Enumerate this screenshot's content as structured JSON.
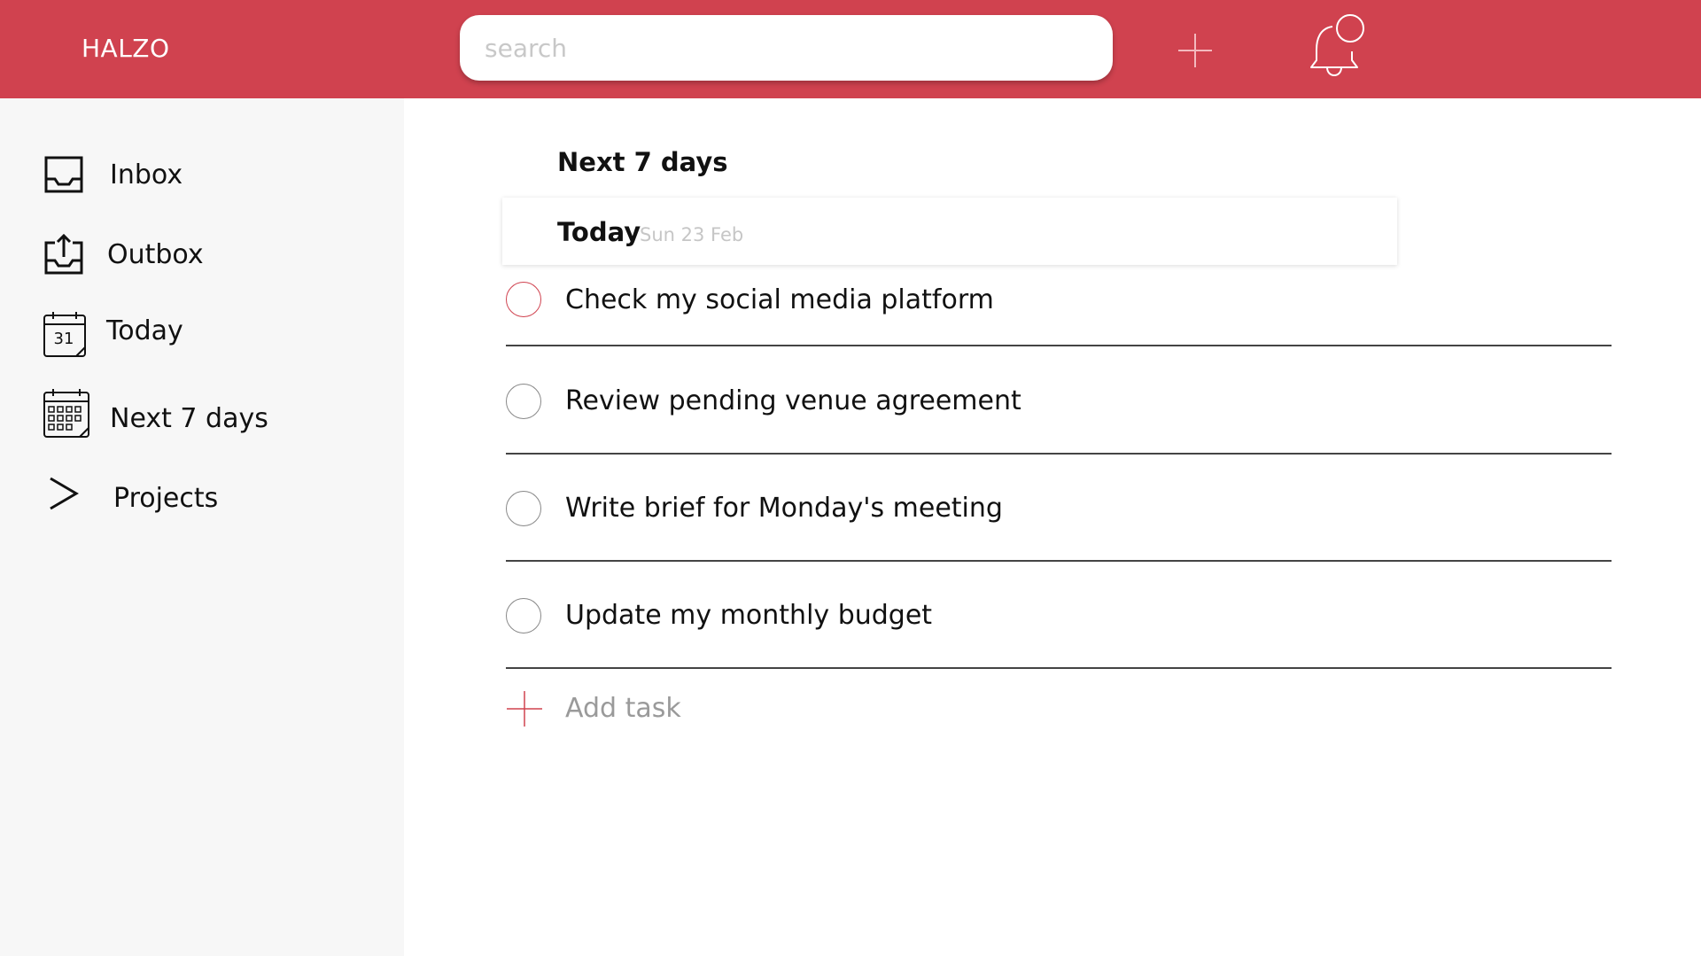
{
  "app": {
    "name": "HALZO"
  },
  "colors": {
    "brand": "#d0424f",
    "sidebar_bg": "#f7f7f7"
  },
  "search": {
    "placeholder": "search",
    "value": ""
  },
  "toolbar": {
    "add_icon": "plus-icon",
    "notifications_icon": "bell-icon"
  },
  "sidebar": {
    "items": [
      {
        "label": "Inbox",
        "icon": "inbox-icon"
      },
      {
        "label": "Outbox",
        "icon": "outbox-icon"
      },
      {
        "label": "Today",
        "icon": "calendar-today-icon",
        "icon_text": "31"
      },
      {
        "label": "Next 7 days",
        "icon": "calendar-week-icon"
      },
      {
        "label": "Projects",
        "icon": "chevron-right-icon"
      }
    ]
  },
  "main": {
    "title": "Next 7 days",
    "day": {
      "title": "Today",
      "date": "Sun 23 Feb"
    },
    "tasks": [
      {
        "text": "Check my social media platform",
        "done": false
      },
      {
        "text": "Review pending venue agreement",
        "done": false
      },
      {
        "text": "Write brief for Monday's meeting",
        "done": false
      },
      {
        "text": "Update my monthly budget",
        "done": false
      }
    ],
    "add_task_label": "Add task"
  }
}
